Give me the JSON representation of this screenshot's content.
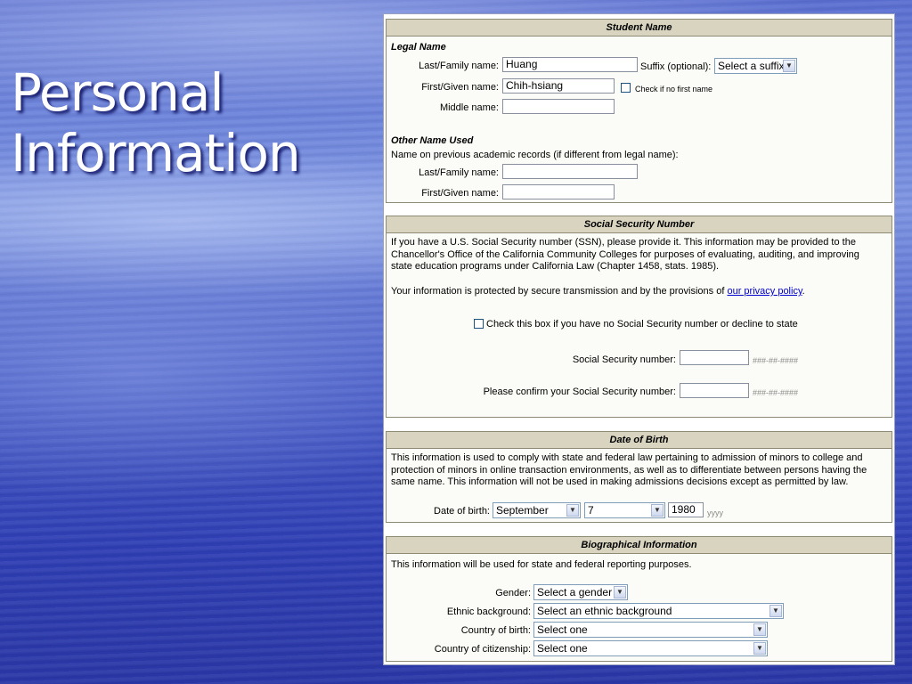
{
  "slide": {
    "title_line1": "Personal",
    "title_line2": "Information"
  },
  "student_name": {
    "header": "Student Name",
    "legal_name_heading": "Legal Name",
    "last_name_label": "Last/Family name:",
    "last_name_value": "Huang",
    "suffix_label": "Suffix (optional):",
    "suffix_value": "Select a suffix",
    "first_name_label": "First/Given name:",
    "first_name_value": "Chih-hsiang",
    "no_first_name_label": "Check if no first name",
    "middle_name_label": "Middle name:",
    "middle_name_value": "",
    "other_name_heading": "Other Name Used",
    "other_name_intro": "Name on previous academic records (if different from legal name):",
    "other_last_label": "Last/Family name:",
    "other_last_value": "",
    "other_first_label": "First/Given name:",
    "other_first_value": ""
  },
  "ssn": {
    "header": "Social Security Number",
    "intro": "If you have a U.S. Social Security number (SSN), please provide it. This information may be provided to the Chancellor's Office of the California Community Colleges for purposes of evaluating, auditing, and improving state education programs under California Law (Chapter 1458, stats. 1985).",
    "privacy_text": "Your information is protected by secure transmission and by the provisions of",
    "privacy_link": "our privacy policy",
    "privacy_end": ".",
    "no_ssn_label": "Check this box if you have no Social Security number or decline to state",
    "ssn_label": "Social Security number:",
    "ssn_value": "",
    "ssn_hint": "###-##-####",
    "confirm_label": "Please confirm your Social Security number:",
    "confirm_value": "",
    "confirm_hint": "###-##-####"
  },
  "dob": {
    "header": "Date of Birth",
    "intro": "This information is used to comply with state and federal law pertaining to admission of minors to college and protection of minors in online transaction environments, as well as to differentiate between persons having the same name. This information will not be used in making admissions decisions except as permitted by law.",
    "label": "Date of birth:",
    "month": "September",
    "day": "7",
    "year": "1980",
    "year_hint": "yyyy"
  },
  "bio": {
    "header": "Biographical Information",
    "intro": "This information will be used for state and federal reporting purposes.",
    "gender_label": "Gender:",
    "gender_value": "Select a gender",
    "ethnic_label": "Ethnic background:",
    "ethnic_value": "Select an ethnic background",
    "birth_country_label": "Country of birth:",
    "birth_country_value": "Select one",
    "citizenship_label": "Country of citizenship:",
    "citizenship_value": "Select one"
  },
  "icons": {
    "dropdown": "chevron-down-icon"
  }
}
